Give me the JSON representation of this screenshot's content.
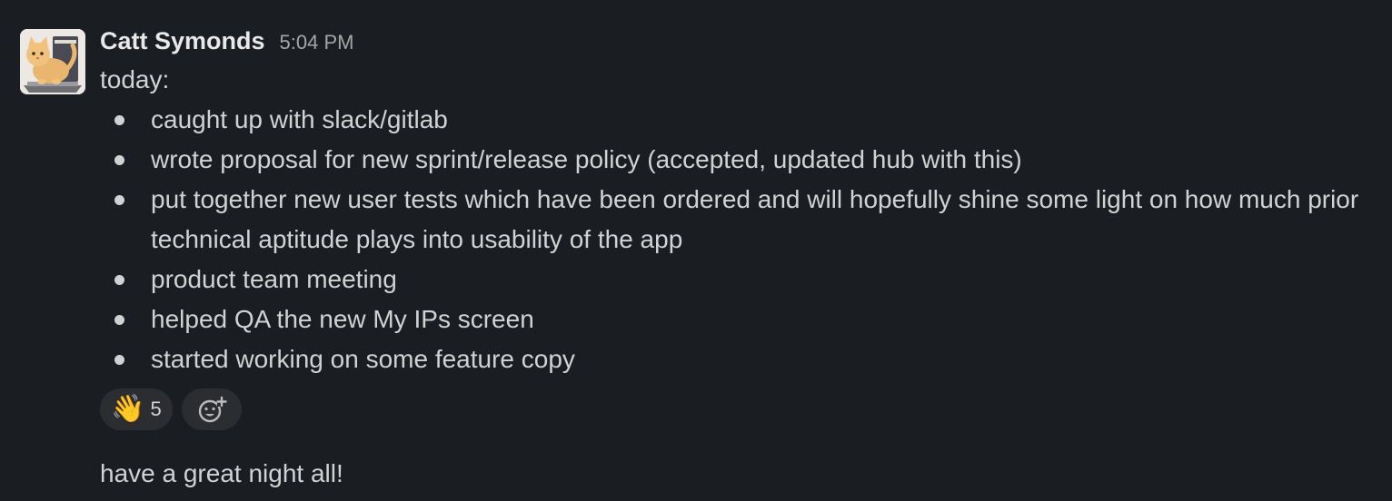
{
  "message": {
    "author": "Catt Symonds",
    "timestamp": "5:04 PM",
    "intro": "today:",
    "bullets": [
      "caught up with slack/gitlab",
      "wrote proposal for new sprint/release policy (accepted, updated hub with this)",
      "put together new user tests which have been ordered and will hopefully shine some light on how much prior technical aptitude plays into usability of the app",
      "product team meeting",
      "helped QA the new My IPs screen",
      "started working on some feature copy"
    ],
    "reactions": [
      {
        "emoji": "👋",
        "count": "5",
        "icon": "waving-hand-icon"
      }
    ],
    "add_reaction_icon": "add-reaction-icon",
    "followup": "have a great night all!"
  },
  "colors": {
    "background": "#1a1d21",
    "text": "#d1d2d3",
    "author": "#e8e8e8",
    "timestamp": "#a5a6a8",
    "reaction_bg": "#2b2d31"
  }
}
